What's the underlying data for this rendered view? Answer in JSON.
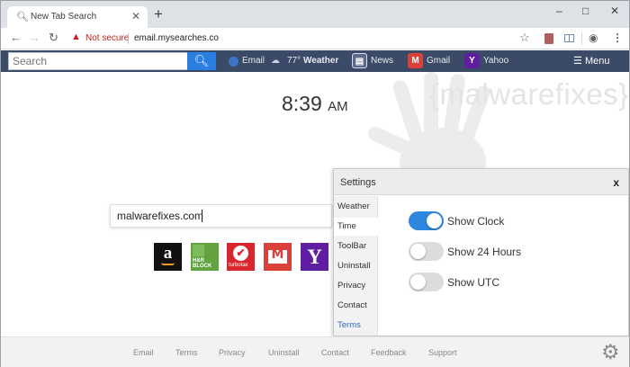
{
  "browser": {
    "tab_title": "New Tab Search",
    "tab_close": "✕",
    "new_tab": "+",
    "security_label": "Not secure",
    "url": "email.mysearches.co"
  },
  "extension_bar": {
    "search_placeholder": "Search",
    "links": {
      "email": "Email",
      "weather_temp": "77°",
      "weather_label": "Weather",
      "news": "News",
      "gmail": "Gmail",
      "yahoo": "Yahoo"
    },
    "menu_label": "Menu",
    "colors": {
      "bar": "#3b4a66",
      "search_button": "#2a7fe0"
    }
  },
  "main": {
    "watermark_text": "{malwarefixes}",
    "clock": {
      "time": "8:39",
      "ampm": "AM"
    },
    "search_value": "malwarefixes.com",
    "tiles": [
      {
        "name": "amazon",
        "glyph": "a",
        "color": "#111111"
      },
      {
        "name": "hr-block",
        "glyph": "H&R BLOCK",
        "color": "#62a33f"
      },
      {
        "name": "turbotax",
        "glyph": "✔ turbotax",
        "color": "#d9262e"
      },
      {
        "name": "gmail",
        "glyph": "M",
        "color": "#d9413a"
      },
      {
        "name": "yahoo",
        "glyph": "Y",
        "color": "#5f1ea1"
      }
    ]
  },
  "settings": {
    "title": "Settings",
    "close": "x",
    "sidebar": [
      "Weather",
      "Time",
      "ToolBar",
      "Uninstall",
      "Privacy",
      "Contact",
      "Terms"
    ],
    "active_item": "Time",
    "options": [
      {
        "label": "Show Clock",
        "on": true
      },
      {
        "label": "Show 24 Hours",
        "on": false
      },
      {
        "label": "Show UTC",
        "on": false
      }
    ],
    "colors": {
      "toggle_on": "#2e86de",
      "toggle_off": "#dcdcdc"
    }
  },
  "footer": {
    "links": [
      "Email",
      "Terms",
      "Privacy",
      "Uninstall",
      "Contact",
      "Feedback",
      "Support"
    ]
  },
  "icons": [
    "search-icon",
    "close-icon",
    "back-arrow-icon",
    "forward-arrow-icon",
    "reload-icon",
    "warning-icon",
    "star-icon",
    "profile-icon",
    "kebab-menu-icon",
    "hamburger-icon",
    "gear-icon"
  ]
}
